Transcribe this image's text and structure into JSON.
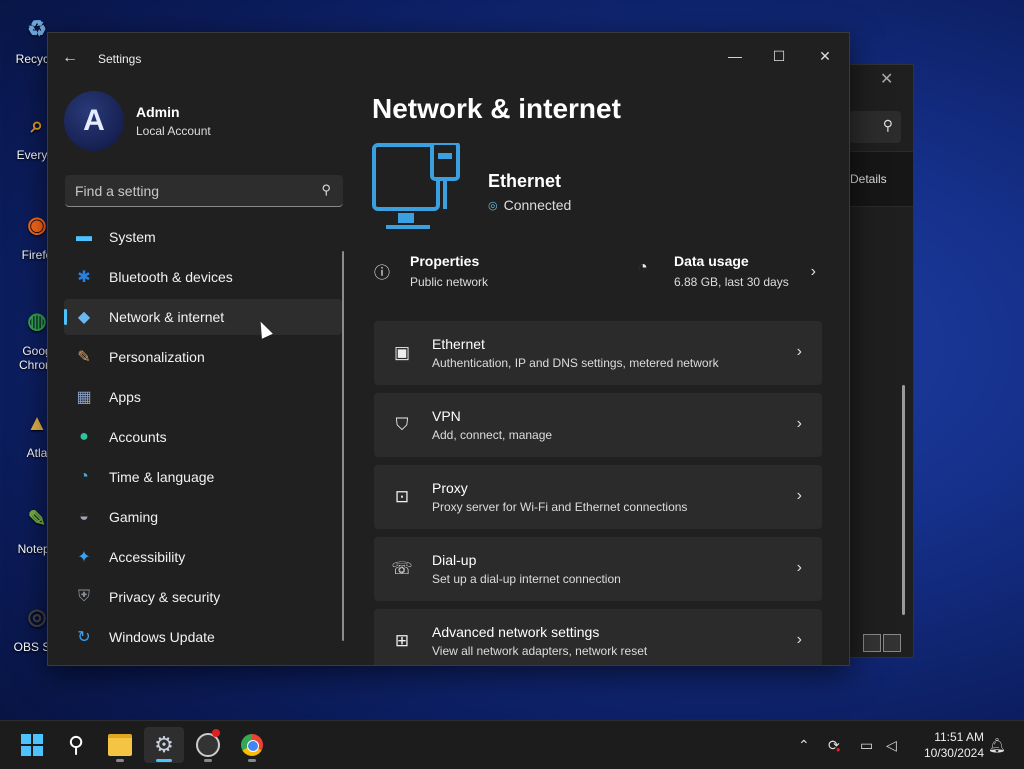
{
  "desktop": {
    "icons": [
      {
        "label": "Recycle",
        "glyph": "♻",
        "color": "#6fa8dc"
      },
      {
        "label": "Everyth",
        "glyph": "⌕",
        "color": "#f0a020"
      },
      {
        "label": "Firefo",
        "glyph": "◉",
        "color": "#ff6a1a"
      },
      {
        "label": "Goog",
        "label2": "Chrom",
        "glyph": "◍",
        "color": "#34a853"
      },
      {
        "label": "Atla",
        "glyph": "▲",
        "color": "#e8b84a"
      },
      {
        "label": "Notepa",
        "glyph": "✎",
        "color": "#7ab648"
      },
      {
        "label": "OBS Stu",
        "glyph": "◎",
        "color": "#444444"
      }
    ]
  },
  "background_window": {
    "details_label": "Details"
  },
  "settings": {
    "window_title": "Settings",
    "profile": {
      "name": "Admin",
      "account_type": "Local Account",
      "avatar_glyph": "A"
    },
    "search": {
      "placeholder": "Find a setting"
    },
    "nav": [
      {
        "label": "System",
        "icon": "system-icon",
        "glyph": "▬",
        "color": "#4cc2ff",
        "active": false
      },
      {
        "label": "Bluetooth & devices",
        "icon": "bluetooth-icon",
        "glyph": "✱",
        "color": "#2b7fe0",
        "active": false
      },
      {
        "label": "Network & internet",
        "icon": "wifi-icon",
        "glyph": "◆",
        "color": "#6ab8f0",
        "active": true
      },
      {
        "label": "Personalization",
        "icon": "brush-icon",
        "glyph": "✎",
        "color": "#e8a060",
        "active": false
      },
      {
        "label": "Apps",
        "icon": "apps-icon",
        "glyph": "▦",
        "color": "#8aa0c8",
        "active": false
      },
      {
        "label": "Accounts",
        "icon": "accounts-icon",
        "glyph": "●",
        "color": "#2ec4a0",
        "active": false
      },
      {
        "label": "Time & language",
        "icon": "globe-clock-icon",
        "glyph": "◔",
        "color": "#4aa8e8",
        "active": false
      },
      {
        "label": "Gaming",
        "icon": "gamepad-icon",
        "glyph": "◒",
        "color": "#a0a8b8",
        "active": false
      },
      {
        "label": "Accessibility",
        "icon": "accessibility-icon",
        "glyph": "✦",
        "color": "#3aa0f0",
        "active": false
      },
      {
        "label": "Privacy & security",
        "icon": "shield-icon",
        "glyph": "⛨",
        "color": "#8a8f98",
        "active": false
      },
      {
        "label": "Windows Update",
        "icon": "update-icon",
        "glyph": "↻",
        "color": "#3aa0f0",
        "active": false
      }
    ],
    "page_title": "Network & internet",
    "connection": {
      "name": "Ethernet",
      "status": "Connected"
    },
    "properties": {
      "title": "Properties",
      "subtitle": "Public network"
    },
    "data_usage": {
      "title": "Data usage",
      "subtitle": "6.88 GB, last 30 days"
    },
    "cards": [
      {
        "title": "Ethernet",
        "subtitle": "Authentication, IP and DNS settings, metered network",
        "icon": "ethernet-icon",
        "glyph": "▣"
      },
      {
        "title": "VPN",
        "subtitle": "Add, connect, manage",
        "icon": "vpn-shield-icon",
        "glyph": "⛉"
      },
      {
        "title": "Proxy",
        "subtitle": "Proxy server for Wi-Fi and Ethernet connections",
        "icon": "proxy-icon",
        "glyph": "⊡"
      },
      {
        "title": "Dial-up",
        "subtitle": "Set up a dial-up internet connection",
        "icon": "dialup-icon",
        "glyph": "☏"
      },
      {
        "title": "Advanced network settings",
        "subtitle": "View all network adapters, network reset",
        "icon": "advanced-network-icon",
        "glyph": "⊞"
      }
    ]
  },
  "taskbar": {
    "time": "11:51 AM",
    "date": "10/30/2024"
  },
  "colors": {
    "accent": "#4cc2ff",
    "window_bg": "#202020",
    "card_bg": "#2b2b2b"
  }
}
